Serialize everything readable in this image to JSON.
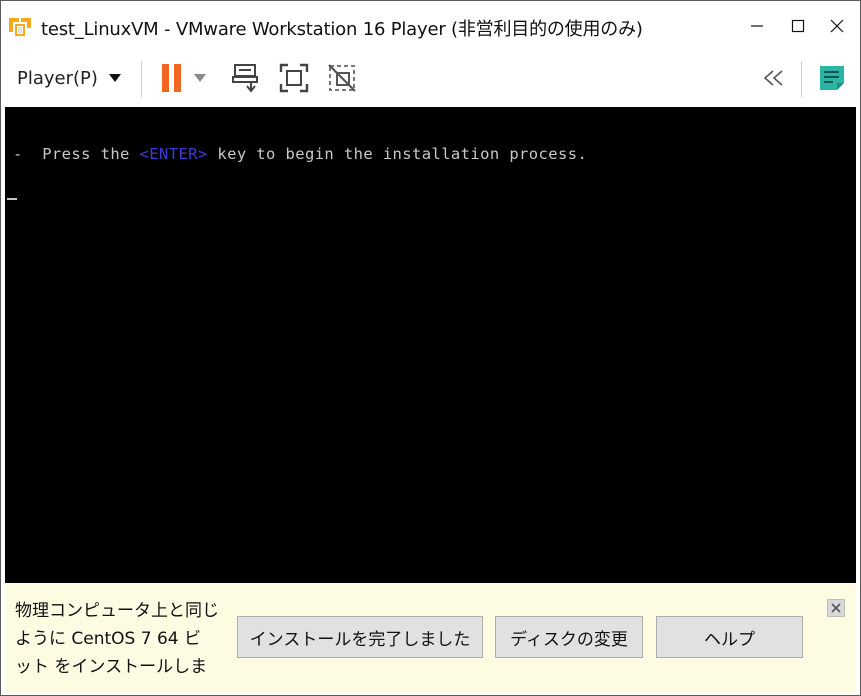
{
  "window": {
    "title": "test_LinuxVM - VMware Workstation 16 Player (非営利目的の使用のみ)"
  },
  "toolbar": {
    "player_menu_label": "Player(P)"
  },
  "icons": {
    "app": "vmware-logo-icon",
    "minimize": "minimize-icon",
    "maximize": "maximize-icon",
    "close": "close-icon",
    "dropdown": "chevron-down-icon",
    "pause": "pause-icon",
    "send_keys": "send-ctrl-alt-del-icon",
    "fullscreen": "fullscreen-icon",
    "unity": "unity-icon",
    "collapse": "double-chevron-left-icon",
    "notes": "notes-icon"
  },
  "colors": {
    "pause_orange": "#f26522",
    "notes_teal": "#2bb5a5",
    "console_bg": "#000000",
    "console_text": "#c8c8c8",
    "enter_key": "#3c3cd8",
    "hintbar_bg": "#fdfbe2"
  },
  "console": {
    "prefix": "-  Press the ",
    "key": "<ENTER>",
    "suffix": " key to begin the installation process."
  },
  "hint": {
    "line1": "物理コンピュータ上と同じ",
    "line2": "ように CentOS 7 64 ビ",
    "line3": "ット をインストールしま",
    "complete_button": "インストールを完了しました",
    "change_disc_button": "ディスクの変更",
    "help_button": "ヘルプ"
  }
}
